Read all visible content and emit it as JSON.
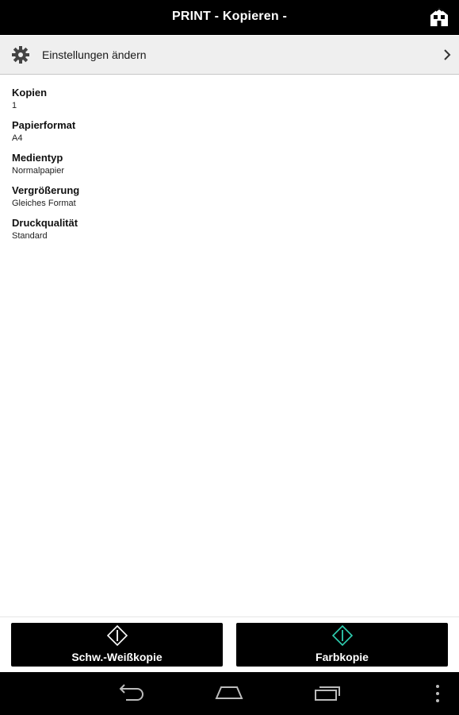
{
  "header": {
    "title": "PRINT  - Kopieren -",
    "home_icon": "home-icon"
  },
  "settings": {
    "label": "Einstellungen ändern",
    "icon": "gear-icon",
    "chevron": "chevron-right-icon"
  },
  "items": [
    {
      "label": "Kopien",
      "value": "1"
    },
    {
      "label": "Papierformat",
      "value": "A4"
    },
    {
      "label": "Medientyp",
      "value": "Normalpapier"
    },
    {
      "label": "Vergrößerung",
      "value": "Gleiches Format"
    },
    {
      "label": "Druckqualität",
      "value": "Standard"
    }
  ],
  "buttons": {
    "bw_label": "Schw.-Weißkopie",
    "color_label": "Farbkopie",
    "bw_icon_color": "#ffffff",
    "color_icon_color": "#2fd0b2"
  },
  "navbar": {
    "back": "back-icon",
    "home": "home-nav-icon",
    "recents": "recents-icon",
    "menu": "overflow-menu-icon"
  }
}
